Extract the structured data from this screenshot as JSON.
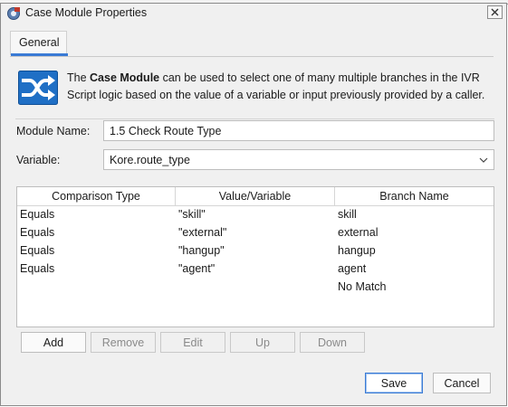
{
  "window": {
    "title": "Case Module Properties",
    "close_icon": "close-icon",
    "app_icon": "app-icon"
  },
  "tabs": [
    {
      "label": "General",
      "active": true
    }
  ],
  "description": {
    "prefix": "The ",
    "bold": "Case Module",
    "line1_rest": " can be used to select one of many multiple branches in the IVR",
    "line2": "Script logic based on the value of a variable or input previously provided by a caller.",
    "icon": "shuffle-branch-icon"
  },
  "form": {
    "module_name_label": "Module Name:",
    "module_name_value": "1.5 Check Route Type",
    "variable_label": "Variable:",
    "variable_value": "Kore.route_type"
  },
  "table": {
    "columns": [
      "Comparison Type",
      "Value/Variable",
      "Branch Name"
    ],
    "rows": [
      [
        "Equals",
        "\"skill\"",
        "skill"
      ],
      [
        "Equals",
        "\"external\"",
        "external"
      ],
      [
        "Equals",
        "\"hangup\"",
        "hangup"
      ],
      [
        "Equals",
        "\"agent\"",
        "agent"
      ],
      [
        "",
        "",
        "No Match"
      ]
    ]
  },
  "row_buttons": {
    "add": "Add",
    "remove": "Remove",
    "edit": "Edit",
    "up": "Up",
    "down": "Down"
  },
  "footer": {
    "save": "Save",
    "cancel": "Cancel"
  },
  "colors": {
    "accent": "#3a7bd5",
    "icon_blue": "#1f6fc5"
  }
}
